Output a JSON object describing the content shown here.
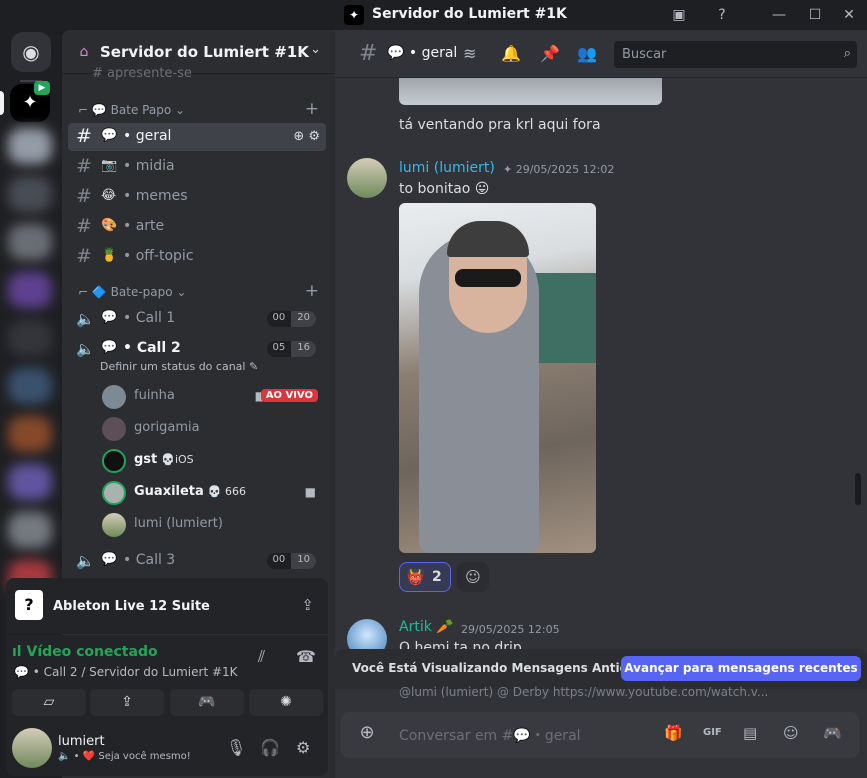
{
  "window": {
    "title": "Servidor do Lumiert #1K"
  },
  "server": {
    "name": "Servidor do Lumiert #1K",
    "partial_channel": "apresente-se"
  },
  "categories": [
    {
      "label": "Bate Papo",
      "emoji": "💬"
    },
    {
      "label": "Bate-papo",
      "emoji": "🔷"
    }
  ],
  "channels": [
    {
      "name": "geral",
      "emoji": "💬",
      "active": true
    },
    {
      "name": "midia",
      "emoji": "📷"
    },
    {
      "name": "memes",
      "emoji": "😂"
    },
    {
      "name": "arte",
      "emoji": "🎨"
    },
    {
      "name": "off-topic",
      "emoji": "🍍"
    }
  ],
  "voice_channels": [
    {
      "name": "Call 1",
      "emoji": "💬",
      "count_a": "00",
      "count_b": "20"
    },
    {
      "name": "Call 2",
      "emoji": "💬",
      "count_a": "05",
      "count_b": "16",
      "status_hint": "Definir um status do canal"
    },
    {
      "name": "Call 3",
      "emoji": "💬",
      "count_a": "00",
      "count_b": "10"
    }
  ],
  "voice_users": [
    {
      "name": "fuinha",
      "live": "AO VIVO"
    },
    {
      "name": "gorigamia"
    },
    {
      "name": "gst",
      "tag": "💀iOS"
    },
    {
      "name": "Guaxileta",
      "tag": "💀 666"
    },
    {
      "name": "lumi (lumiert)"
    }
  ],
  "activity": {
    "name": "Ableton Live 12 Suite",
    "icon": "?"
  },
  "voice_panel": {
    "status": "Vídeo conectado",
    "sub": "• Call 2 / Servidor do Lumiert #1K"
  },
  "user": {
    "name": "lumiert",
    "status": "Seja você mesmo!"
  },
  "chat": {
    "channel": "geral",
    "search_placeholder": "Buscar",
    "messages": [
      {
        "text": "tá ventando pra krl aqui fora"
      },
      {
        "author": "lumi (lumiert)",
        "timestamp": "29/05/2025 12:02",
        "text": "to bonitao 😛",
        "reaction": {
          "emoji": "👹",
          "count": "2"
        }
      },
      {
        "author": "Artik",
        "timestamp": "29/05/2025 12:05",
        "text": "O hemi ta no drip"
      }
    ],
    "quote": "@lumi (lumiert) @ Derby https://www.youtube.com/watch.v...",
    "old_messages_notice": "Você Está Visualizando Mensagens Antigas",
    "jump_button": "Avançar para mensagens recentes",
    "composer_placeholder": "Conversar em #💬・geral"
  },
  "colors": {
    "accent": "#5865f2",
    "online": "#23a559",
    "live": "#da373c",
    "link_author": "#3ab7e6"
  }
}
